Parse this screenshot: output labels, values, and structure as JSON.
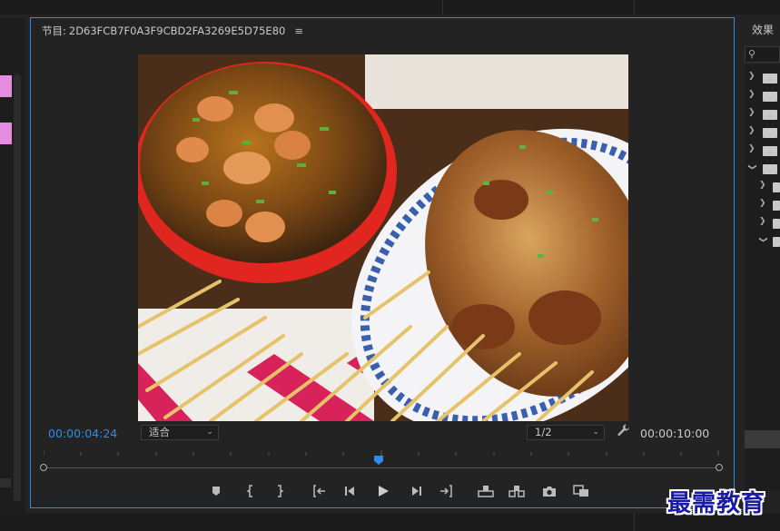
{
  "monitor": {
    "title_label": "节目:",
    "sequence_name": "2D63FCB7F0A3F9CBD2FA3269E5D75E80",
    "menu_icon": "hamburger-menu-icon",
    "current_timecode": "00:00:04:24",
    "duration_timecode": "00:00:10:00",
    "zoom_fit": "适合",
    "resolution": "1/2",
    "playhead_fraction": 0.49,
    "frame_content": "food-photo-noodles-and-skewers"
  },
  "controls": [
    {
      "name": "add-marker-button",
      "icon": "marker-icon"
    },
    {
      "name": "mark-in-button",
      "icon": "mark-in-icon"
    },
    {
      "name": "mark-out-button",
      "icon": "mark-out-icon"
    },
    {
      "name": "go-to-in-button",
      "icon": "go-to-in-icon"
    },
    {
      "name": "step-back-button",
      "icon": "step-back-icon"
    },
    {
      "name": "play-button",
      "icon": "play-icon"
    },
    {
      "name": "step-forward-button",
      "icon": "step-forward-icon"
    },
    {
      "name": "go-to-out-button",
      "icon": "go-to-out-icon"
    },
    {
      "name": "lift-button",
      "icon": "lift-icon"
    },
    {
      "name": "extract-button",
      "icon": "extract-icon"
    },
    {
      "name": "export-frame-button",
      "icon": "camera-icon"
    },
    {
      "name": "compare-view-button",
      "icon": "compare-icon"
    }
  ],
  "effects_panel": {
    "title": "效果",
    "search_icon": "search-icon"
  },
  "watermark": "最需教育",
  "colors": {
    "accent": "#2d8ceb",
    "background": "#232323",
    "label_pink": "#e58be0",
    "watermark": "#1a1aa8"
  }
}
